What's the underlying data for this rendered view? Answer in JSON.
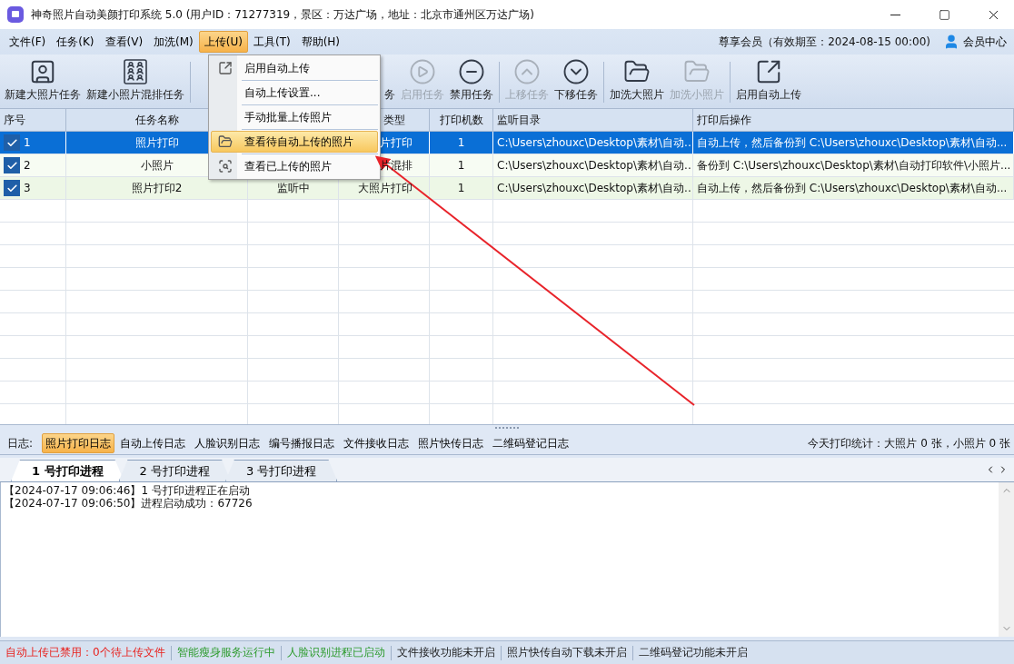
{
  "window": {
    "title": "神奇照片自动美颜打印系统 5.0 (用户ID：71277319，景区：万达广场，地址：北京市通州区万达广场)"
  },
  "menubar": {
    "items": [
      {
        "label": "文件(F)",
        "selected": false
      },
      {
        "label": "任务(K)",
        "selected": false
      },
      {
        "label": "查看(V)",
        "selected": false
      },
      {
        "label": "加洗(M)",
        "selected": false
      },
      {
        "label": "上传(U)",
        "selected": true
      },
      {
        "label": "工具(T)",
        "selected": false
      },
      {
        "label": "帮助(H)",
        "selected": false
      }
    ],
    "membership": "尊享会员（有效期至：2024-08-15 00:00)",
    "member_center": "会员中心"
  },
  "toolbar": [
    {
      "kind": "button",
      "label": "新建大照片任务",
      "disabled": false
    },
    {
      "kind": "button",
      "label": "新建小照片混排任务",
      "disabled": false
    },
    {
      "kind": "separator"
    },
    {
      "kind": "partial",
      "label": "务"
    },
    {
      "kind": "button",
      "label": "启用任务",
      "disabled": true
    },
    {
      "kind": "button",
      "label": "禁用任务",
      "disabled": false
    },
    {
      "kind": "separator"
    },
    {
      "kind": "button",
      "label": "上移任务",
      "disabled": true
    },
    {
      "kind": "button",
      "label": "下移任务",
      "disabled": false
    },
    {
      "kind": "separator"
    },
    {
      "kind": "button",
      "label": "加洗大照片",
      "disabled": false
    },
    {
      "kind": "button",
      "label": "加洗小照片",
      "disabled": true
    },
    {
      "kind": "separator"
    },
    {
      "kind": "button",
      "label": "启用自动上传",
      "disabled": false
    }
  ],
  "dropdown": [
    {
      "label": "启用自动上传",
      "selected": false
    },
    {
      "label": "自动上传设置...",
      "selected": false
    },
    {
      "label": "手动批量上传照片",
      "selected": false
    },
    {
      "label": "查看待自动上传的照片",
      "selected": true
    },
    {
      "label": "查看已上传的照片",
      "selected": false
    }
  ],
  "table": {
    "columns": {
      "seq": "序号",
      "name": "任务名称",
      "column_4": "类型",
      "printers": "打印机数",
      "folder": "监听目录",
      "after": "打印后操作"
    },
    "rows": [
      {
        "checked": true,
        "selected": true,
        "seq": "1",
        "name": "照片打印",
        "column_4": "片打印",
        "printers": "1",
        "folder": "C:\\Users\\zhouxc\\Desktop\\素材\\自动...",
        "after": "自动上传，然后备份到 C:\\Users\\zhouxc\\Desktop\\素材\\自动..."
      },
      {
        "checked": true,
        "selected": false,
        "seq": "2",
        "name": "小照片",
        "column_4": "片混排",
        "printers": "1",
        "folder": "C:\\Users\\zhouxc\\Desktop\\素材\\自动...",
        "after": "备份到 C:\\Users\\zhouxc\\Desktop\\素材\\自动打印软件\\小照片..."
      },
      {
        "checked": true,
        "selected": false,
        "seq": "3",
        "name": "照片打印2",
        "column_3": "监听中",
        "column_4": "大照片打印",
        "printers": "1",
        "folder": "C:\\Users\\zhouxc\\Desktop\\素材\\自动...",
        "after": "自动上传，然后备份到 C:\\Users\\zhouxc\\Desktop\\素材\\自动..."
      }
    ]
  },
  "log_bar": {
    "label": "日志:",
    "tabs": [
      {
        "label": "照片打印日志",
        "selected": true
      },
      {
        "label": "自动上传日志",
        "selected": false
      },
      {
        "label": "人脸识别日志",
        "selected": false
      },
      {
        "label": "编号播报日志",
        "selected": false
      },
      {
        "label": "文件接收日志",
        "selected": false
      },
      {
        "label": "照片快传日志",
        "selected": false
      },
      {
        "label": "二维码登记日志",
        "selected": false
      }
    ],
    "stats": "今天打印统计：大照片 0 张，小照片 0 张"
  },
  "process_tabs": [
    {
      "label": "1 号打印进程",
      "selected": true
    },
    {
      "label": "2 号打印进程",
      "selected": false
    },
    {
      "label": "3 号打印进程",
      "selected": false
    }
  ],
  "log_lines": [
    "【2024-07-17 09:06:46】1 号打印进程正在启动",
    "【2024-07-17 09:06:50】进程启动成功：67726"
  ],
  "status_bar": [
    {
      "text": "自动上传已禁用：0个待上传文件",
      "kind": "error"
    },
    {
      "text": "智能瘦身服务运行中",
      "kind": "running"
    },
    {
      "text": "人脸识别进程已启动",
      "kind": "running"
    },
    {
      "text": "文件接收功能未开启",
      "kind": "off"
    },
    {
      "text": "照片快传自动下载未开启",
      "kind": "off"
    },
    {
      "text": "二维码登记功能未开启",
      "kind": "off"
    }
  ]
}
